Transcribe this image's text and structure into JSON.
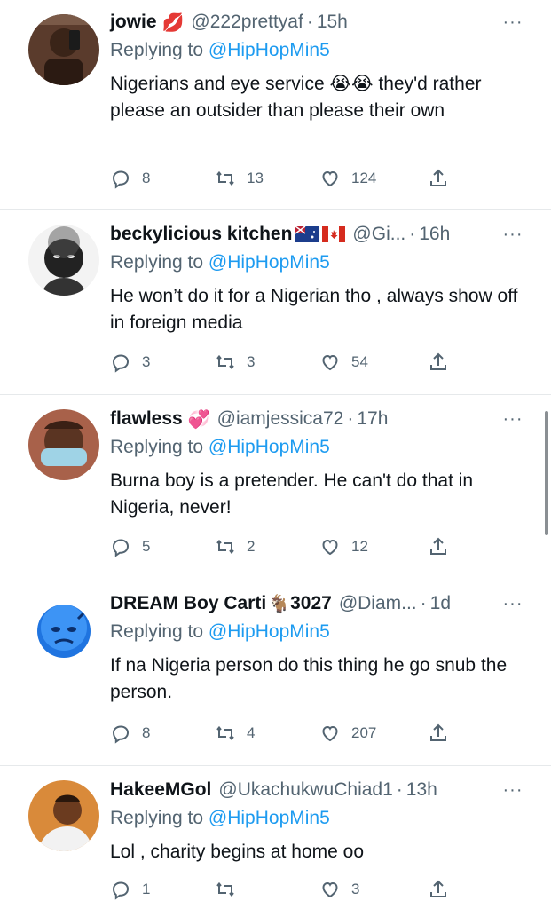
{
  "tweets": [
    {
      "name": "jowie",
      "name_emoji": "💋",
      "handle": "@222prettyaf",
      "dot": "·",
      "time": "15h",
      "replying_prefix": "Replying to",
      "replying_to": "@HipHopMin5",
      "text_before": "Nigerians and eye service",
      "text_emoji": "😭😭",
      "text_after": " they'd rather please an outsider than please their own",
      "replies": "8",
      "retweets": "13",
      "likes": "124"
    },
    {
      "name": "beckylicious kitchen",
      "name_emoji": "",
      "handle": "@Gi...",
      "dot": "·",
      "time": "16h",
      "replying_prefix": "Replying to",
      "replying_to": "@HipHopMin5",
      "text": "He won’t do it for a Nigerian tho , always show off in foreign media",
      "replies": "3",
      "retweets": "3",
      "likes": "54"
    },
    {
      "name": "flawless",
      "name_emoji": "💞",
      "handle": "@iamjessica72",
      "dot": "·",
      "time": "17h",
      "replying_prefix": "Replying to",
      "replying_to": "@HipHopMin5",
      "text": "Burna boy is a pretender. He can't do that in Nigeria, never!",
      "replies": "5",
      "retweets": "2",
      "likes": "12"
    },
    {
      "name": "DREAM Boy Carti",
      "name_emoji": "🐐",
      "name_suffix": "3027",
      "handle": "@Diam...",
      "dot": "·",
      "time": "1d",
      "replying_prefix": "Replying to",
      "replying_to": "@HipHopMin5",
      "text": "If na Nigeria person do this thing he go snub the person.",
      "replies": "8",
      "retweets": "4",
      "likes": "207"
    },
    {
      "name": "HakeeMGol",
      "name_emoji": "",
      "handle": "@UkachukwuChiad1",
      "dot": "·",
      "time": "13h",
      "replying_prefix": "Replying to",
      "replying_to": "@HipHopMin5",
      "text": "Lol , charity begins at home oo",
      "replies": "1",
      "retweets": "",
      "likes": "3"
    }
  ],
  "more_label": "···",
  "colors": {
    "text": "#0f1419",
    "muted": "#536471",
    "link": "#1d9bf0",
    "divider": "#e6e9eb"
  },
  "icons": [
    "reply-icon",
    "retweet-icon",
    "like-icon",
    "share-icon",
    "more-icon"
  ]
}
